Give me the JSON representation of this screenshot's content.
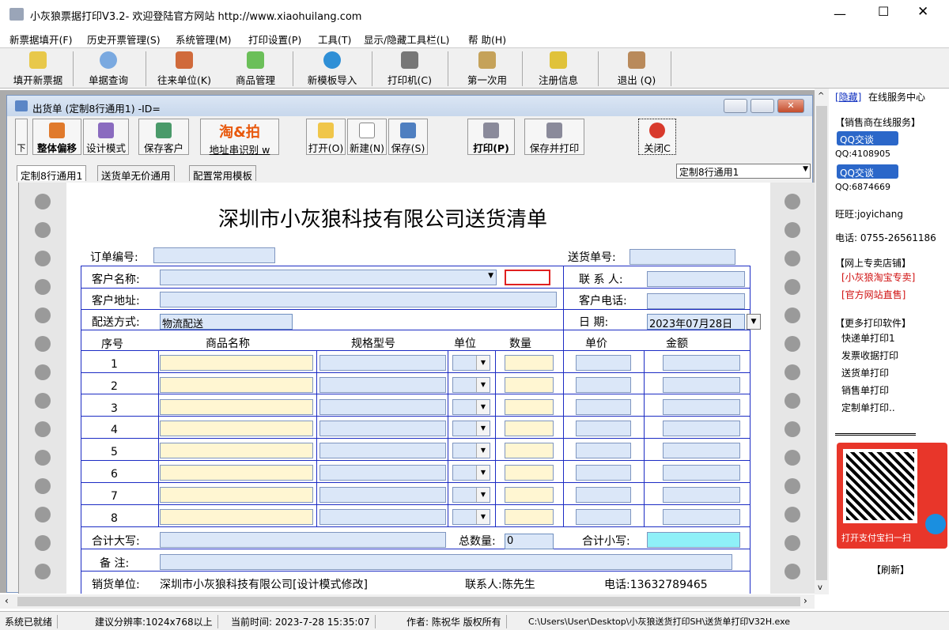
{
  "window": {
    "title": "小灰狼票据打印V3.2- 欢迎登陆官方网站 http://www.xiaohuilang.com"
  },
  "menu": [
    "新票据填开(F)",
    "历史开票管理(S)",
    "系统管理(M)",
    "打印设置(P)",
    "工具(T)",
    "显示/隐藏工具栏(L)",
    "帮 助(H)"
  ],
  "toolbar": [
    "填开新票据",
    "单据查询",
    "往来单位(K)",
    "商品管理",
    "新模板导入",
    "打印机(C)",
    "第一次用",
    "注册信息",
    "退出 (Q)"
  ],
  "child": {
    "title": "出货单 (定制8行通用1) -ID="
  },
  "ctool": {
    "down": "下",
    "move": "整体偏移",
    "design": "设计模式",
    "save_customer": "保存客户",
    "taobao_logo": "淘&拍",
    "addr_recog": "地址串识别 w",
    "open": "打开(O)",
    "new": "新建(N)",
    "save": "保存(S)",
    "print": "打印(P)",
    "save_print": "保存并打印",
    "close": "关闭C"
  },
  "tabs": [
    "定制8行通用1",
    "送货单无价通用",
    "配置常用模板"
  ],
  "template_select": "定制8行通用1",
  "form": {
    "title": "深圳市小灰狼科技有限公司送货清单",
    "order_no_label": "订单编号:",
    "delivery_no_label": "送货单号:",
    "customer_label": "客户名称:",
    "contact_label": "联 系 人:",
    "address_label": "客户地址:",
    "phone_label": "客户电话:",
    "shipping_label": "配送方式:",
    "shipping_value": "物流配送",
    "date_label": "日  期:",
    "date_value": "2023年07月28日",
    "columns": [
      "序号",
      "商品名称",
      "规格型号",
      "单位",
      "数量",
      "单价",
      "金额"
    ],
    "rows": [
      "1",
      "2",
      "3",
      "4",
      "5",
      "6",
      "7",
      "8"
    ],
    "total_upper_label": "合计大写:",
    "total_qty_label": "总数量:",
    "total_qty_value": "0",
    "subtotal_label": "合计小写:",
    "note_label": "备  注:",
    "seller_label": "销货单位:",
    "seller_value": "深圳市小灰狼科技有限公司[设计模式修改]",
    "seller_contact": "联系人:陈先生",
    "seller_phone": "电话:13632789465"
  },
  "side": {
    "hide": "[隐藏]",
    "service": "在线服务中心",
    "sales": "【销售商在线服务】",
    "qq_btn": "QQ交谈",
    "qq1": "QQ:4108905",
    "qq2": "QQ:6874669",
    "wangwang": "旺旺:joyichang",
    "tel": "电话: 0755-26561186",
    "shop": "【网上专卖店铺】",
    "shop1": "[小灰狼淘宝专卖]",
    "shop2": "[官方网站直售]",
    "more": "【更多打印软件】",
    "sw": [
      "快递单打印1",
      "发票收据打印",
      "送货单打印",
      "销售单打印",
      "定制单打印.."
    ],
    "alipay": "打开支付宝扫一扫",
    "refresh": "【刷新】"
  },
  "status": [
    "系统已就绪",
    "建议分辨率:1024x768以上",
    "当前时间: 2023-7-28 15:35:07",
    "作者: 陈祝华 版权所有",
    "C:\\Users\\User\\Desktop\\小灰狼送货打印SH\\送货单打印V32H.exe"
  ]
}
